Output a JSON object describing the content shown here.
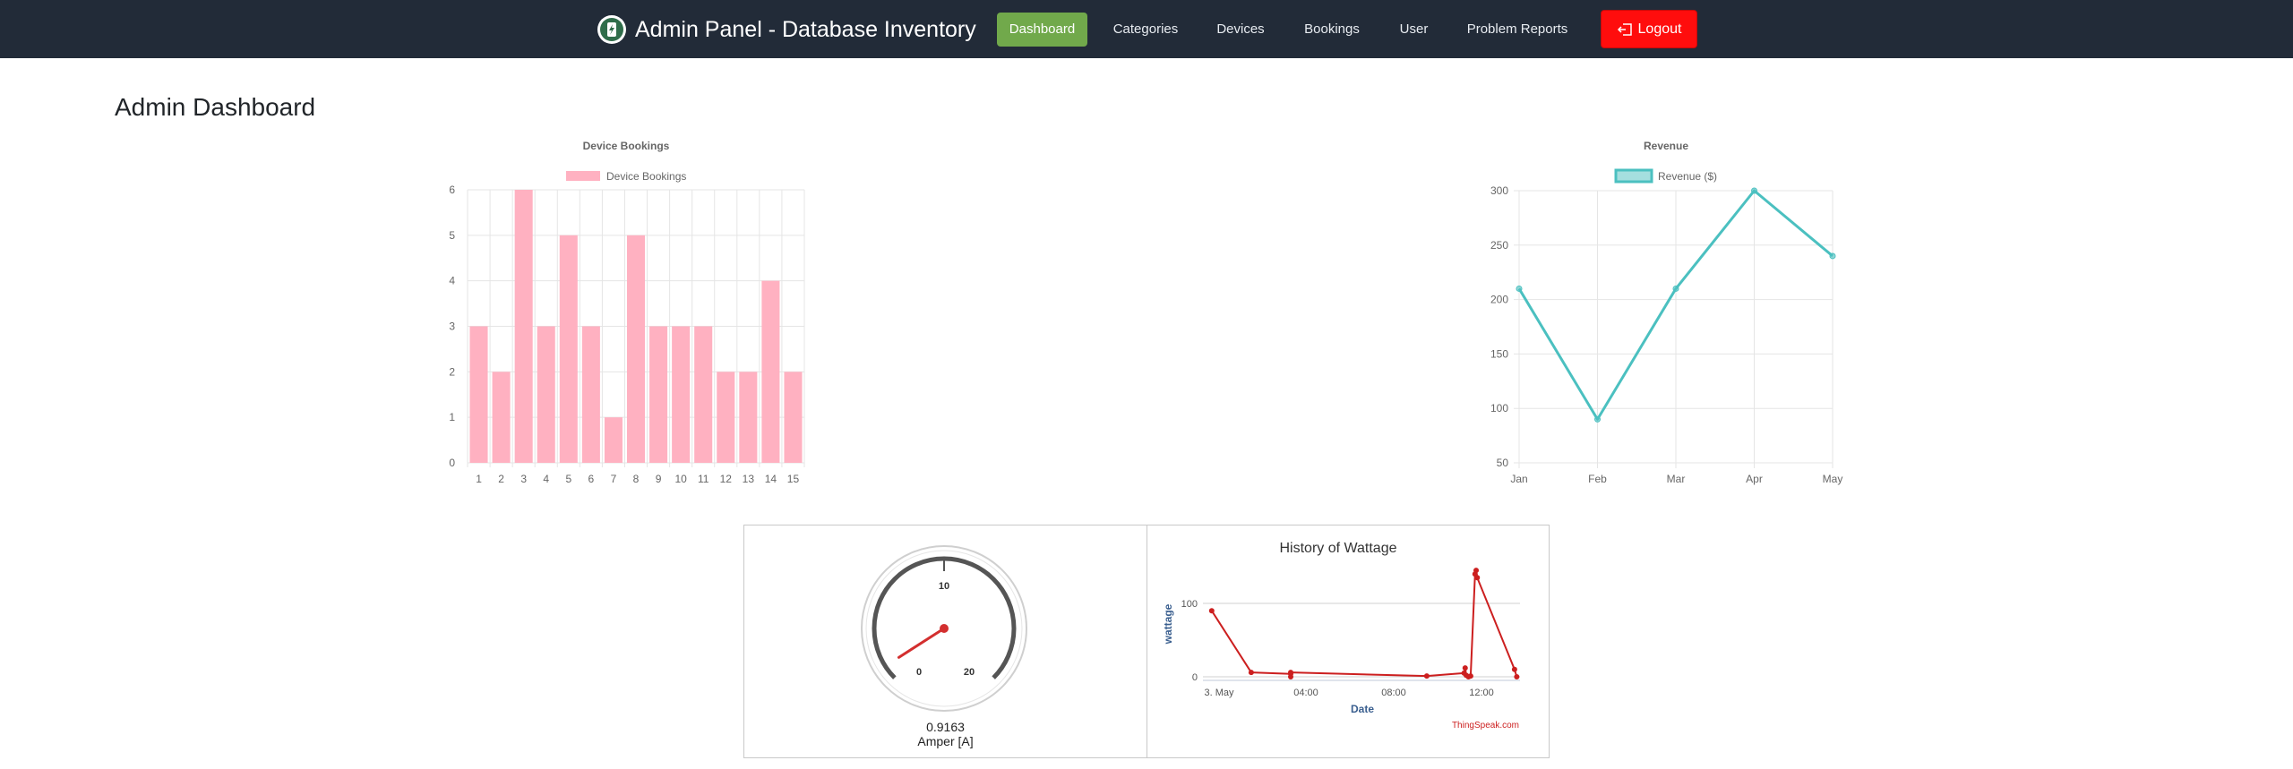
{
  "navbar": {
    "brand_title": "Admin Panel - Database Inventory",
    "items": [
      {
        "label": "Dashboard",
        "active": true
      },
      {
        "label": "Categories"
      },
      {
        "label": "Devices"
      },
      {
        "label": "Bookings"
      },
      {
        "label": "User"
      },
      {
        "label": "Problem Reports"
      }
    ],
    "logout_label": "Logout",
    "bg_color": "#222b38",
    "active_color": "#71a94b",
    "logout_color": "#ff0d0d"
  },
  "page": {
    "title": "Admin Dashboard"
  },
  "chart_data": [
    {
      "type": "bar",
      "title": "Device Bookings",
      "categories": [
        "1",
        "2",
        "3",
        "4",
        "5",
        "6",
        "7",
        "8",
        "9",
        "10",
        "11",
        "12",
        "13",
        "14",
        "15"
      ],
      "series": [
        {
          "name": "Device Bookings",
          "values": [
            3,
            2,
            6,
            3,
            5,
            3,
            1,
            5,
            3,
            3,
            3,
            2,
            2,
            4,
            2
          ],
          "color": "#ffb1c1"
        }
      ],
      "yticks": [
        "0",
        "1",
        "2",
        "3",
        "4",
        "5",
        "6"
      ],
      "ylim": [
        0,
        6
      ],
      "grid": true,
      "legend": "top"
    },
    {
      "type": "line",
      "title": "Revenue",
      "categories": [
        "Jan",
        "Feb",
        "Mar",
        "Apr",
        "May"
      ],
      "series": [
        {
          "name": "Revenue ($)",
          "values": [
            210,
            90,
            210,
            300,
            240
          ],
          "color": "#4bc0c0"
        }
      ],
      "yticks": [
        "50",
        "100",
        "150",
        "200",
        "250",
        "300"
      ],
      "ylim": [
        50,
        300
      ],
      "grid": true,
      "legend": "top"
    },
    {
      "type": "gauge",
      "value": "0.9163",
      "unit_label": "Amper [A]",
      "numeric_value": 0.9163,
      "range": [
        0,
        20
      ],
      "tick_labels": [
        "0",
        "10",
        "20"
      ],
      "needle_color": "#d32f2f"
    },
    {
      "type": "line",
      "title": "History of Wattage",
      "xlabel": "Date",
      "ylabel": "wattage",
      "xticks": [
        "3. May",
        "04:00",
        "08:00",
        "12:00"
      ],
      "yticks": [
        "0",
        "100"
      ],
      "ylim": [
        0,
        100
      ],
      "credit": "ThingSpeak.com",
      "series": [
        {
          "color": "#cc1f1f",
          "points": [
            [
              0.4,
              90
            ],
            [
              2.2,
              6
            ],
            [
              4.0,
              4
            ],
            [
              4.0,
              0
            ],
            [
              4.0,
              6
            ],
            [
              10.2,
              1
            ],
            [
              11.9,
              5
            ],
            [
              11.95,
              12
            ],
            [
              12.0,
              2
            ],
            [
              12.1,
              0
            ],
            [
              12.2,
              1
            ],
            [
              12.4,
              140
            ],
            [
              12.45,
              145
            ],
            [
              12.5,
              135
            ],
            [
              14.2,
              10
            ],
            [
              14.3,
              0
            ]
          ]
        }
      ]
    }
  ]
}
